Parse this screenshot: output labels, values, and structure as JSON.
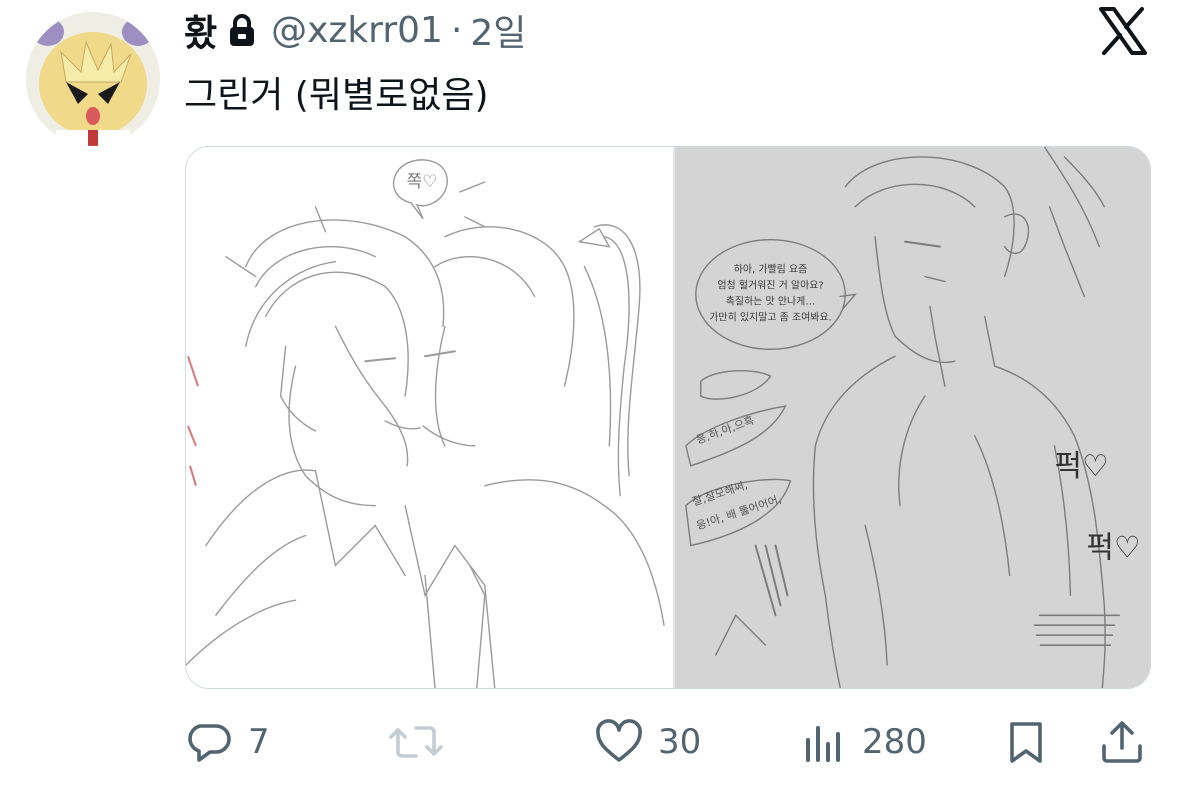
{
  "tweet": {
    "display_name": "홨",
    "handle": "@xzkrr01",
    "separator": "·",
    "time": "2일",
    "text": "그린거 (뭐별로없음)"
  },
  "media": {
    "left_image": {
      "speech_bubble": "쪽♡"
    },
    "right_image": {
      "speech_bubble_lines": [
        "하아, 가빨림 요즘",
        "엄청 헐거워진 거 알아요?",
        "촉질하는 맛 안나게…",
        "가만히 있지말고 좀 조여봐요."
      ],
      "side_notes": [
        "응,하,아,으흑",
        "잘,잘모해써,",
        "응!아, 배 뚫어어어,"
      ],
      "sfx": [
        "퍽♡",
        "퍽♡"
      ]
    }
  },
  "actions": {
    "reply": {
      "icon": "reply-icon",
      "count": "7"
    },
    "retweet": {
      "icon": "retweet-icon",
      "count": ""
    },
    "like": {
      "icon": "heart-icon",
      "count": "30"
    },
    "views": {
      "icon": "views-icon",
      "count": "280"
    },
    "bookmark": {
      "icon": "bookmark-icon"
    },
    "share": {
      "icon": "share-icon"
    }
  },
  "colors": {
    "text_primary": "#0f1419",
    "text_secondary": "#536471",
    "border": "#cfd9de"
  }
}
